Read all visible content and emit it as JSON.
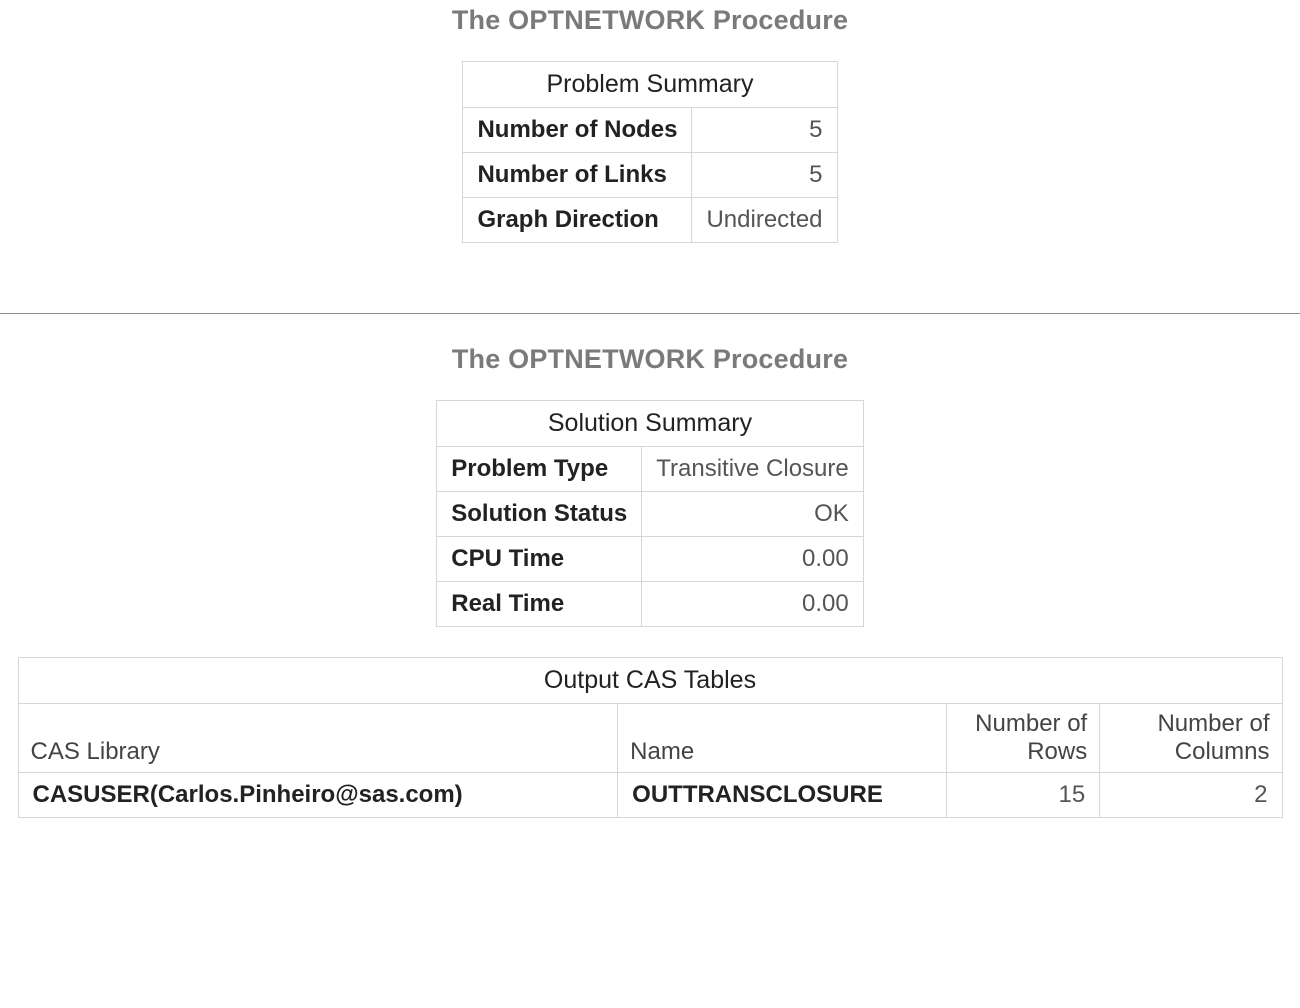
{
  "section1": {
    "title": "The OPTNETWORK Procedure",
    "table": {
      "caption": "Problem Summary",
      "rows": [
        {
          "label": "Number of Nodes",
          "value": "5",
          "align": "right"
        },
        {
          "label": "Number of Links",
          "value": "5",
          "align": "right"
        },
        {
          "label": "Graph Direction",
          "value": "Undirected",
          "align": "left"
        }
      ]
    }
  },
  "section2": {
    "title": "The OPTNETWORK Procedure",
    "solution_table": {
      "caption": "Solution Summary",
      "rows": [
        {
          "label": "Problem Type",
          "value": "Transitive Closure",
          "align": "left"
        },
        {
          "label": "Solution Status",
          "value": "OK",
          "align": "right"
        },
        {
          "label": "CPU Time",
          "value": "0.00",
          "align": "right"
        },
        {
          "label": "Real Time",
          "value": "0.00",
          "align": "right"
        }
      ]
    },
    "cas_table": {
      "caption": "Output CAS Tables",
      "headers": {
        "cas_library": "CAS Library",
        "name": "Name",
        "num_rows": "Number of Rows",
        "num_cols": "Number of Columns"
      },
      "rows": [
        {
          "cas_library": "CASUSER(Carlos.Pinheiro@sas.com)",
          "name": "OUTTRANSCLOSURE",
          "num_rows": "15",
          "num_cols": "2"
        }
      ]
    }
  }
}
